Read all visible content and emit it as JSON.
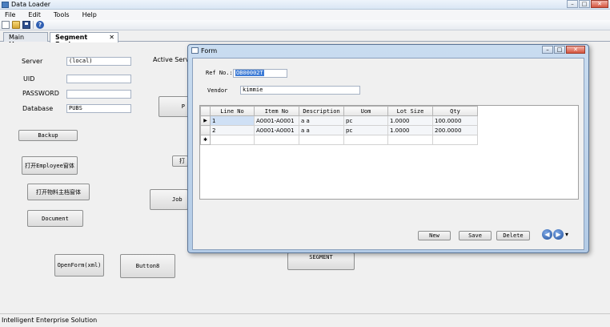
{
  "window": {
    "title": "Data Loader",
    "controls": {
      "minimize": "–",
      "maximize": "□",
      "close": "✕"
    }
  },
  "menu": {
    "items": [
      "File",
      "Edit",
      "Tools",
      "Help"
    ]
  },
  "toolbar": {
    "icons": [
      "new-document-icon",
      "open-folder-icon",
      "save-icon",
      "help-icon"
    ],
    "help_glyph": "?"
  },
  "tabs": [
    {
      "label": "Main Menu",
      "active": false
    },
    {
      "label": "Segment Explorer",
      "active": true,
      "close": "✕"
    }
  ],
  "main": {
    "server_label": "Server",
    "server_value": "(local)",
    "uid_label": "UID",
    "uid_value": "",
    "password_label": "PASSWORD",
    "password_value": "",
    "database_label": "Database",
    "database_value": "PUBS",
    "active_server_label": "Active Server",
    "buttons": {
      "backup": "Backup",
      "open_employee": "打开Employee窗体",
      "open_material": "打开物料主档窗体",
      "document": "Document",
      "openform_xml": "OpenForm(xml)",
      "button8": "Button8",
      "job": "Job",
      "partial_1": "P",
      "partial_2": "打",
      "partial_3": "SEGMENT"
    }
  },
  "form": {
    "title": "Form",
    "ref_no_label": "Ref No.:",
    "ref_no_value": "OB00002T",
    "vendor_label": "Vendor",
    "vendor_value": "kimmie",
    "grid": {
      "columns": [
        "Line No",
        "Item No",
        "Description",
        "Uom",
        "Lot Size",
        "Qty"
      ],
      "rows": [
        {
          "indicator": "▶",
          "line_no": "1",
          "item_no": "A0001-A0001",
          "description": "a a",
          "uom": "pc",
          "lot_size": "1.0000",
          "qty": "100.0000"
        },
        {
          "indicator": "",
          "line_no": "2",
          "item_no": "A0001-A0001",
          "description": "a a",
          "uom": "pc",
          "lot_size": "1.0000",
          "qty": "200.0000"
        }
      ],
      "new_row_indicator": "✱"
    },
    "buttons": {
      "new": "New",
      "save": "Save",
      "delete": "Delete"
    },
    "nav": {
      "back": "◀",
      "forward": "▶",
      "dropdown": "▾"
    }
  },
  "status": {
    "text": "Intelligent Enterprise Solution"
  }
}
